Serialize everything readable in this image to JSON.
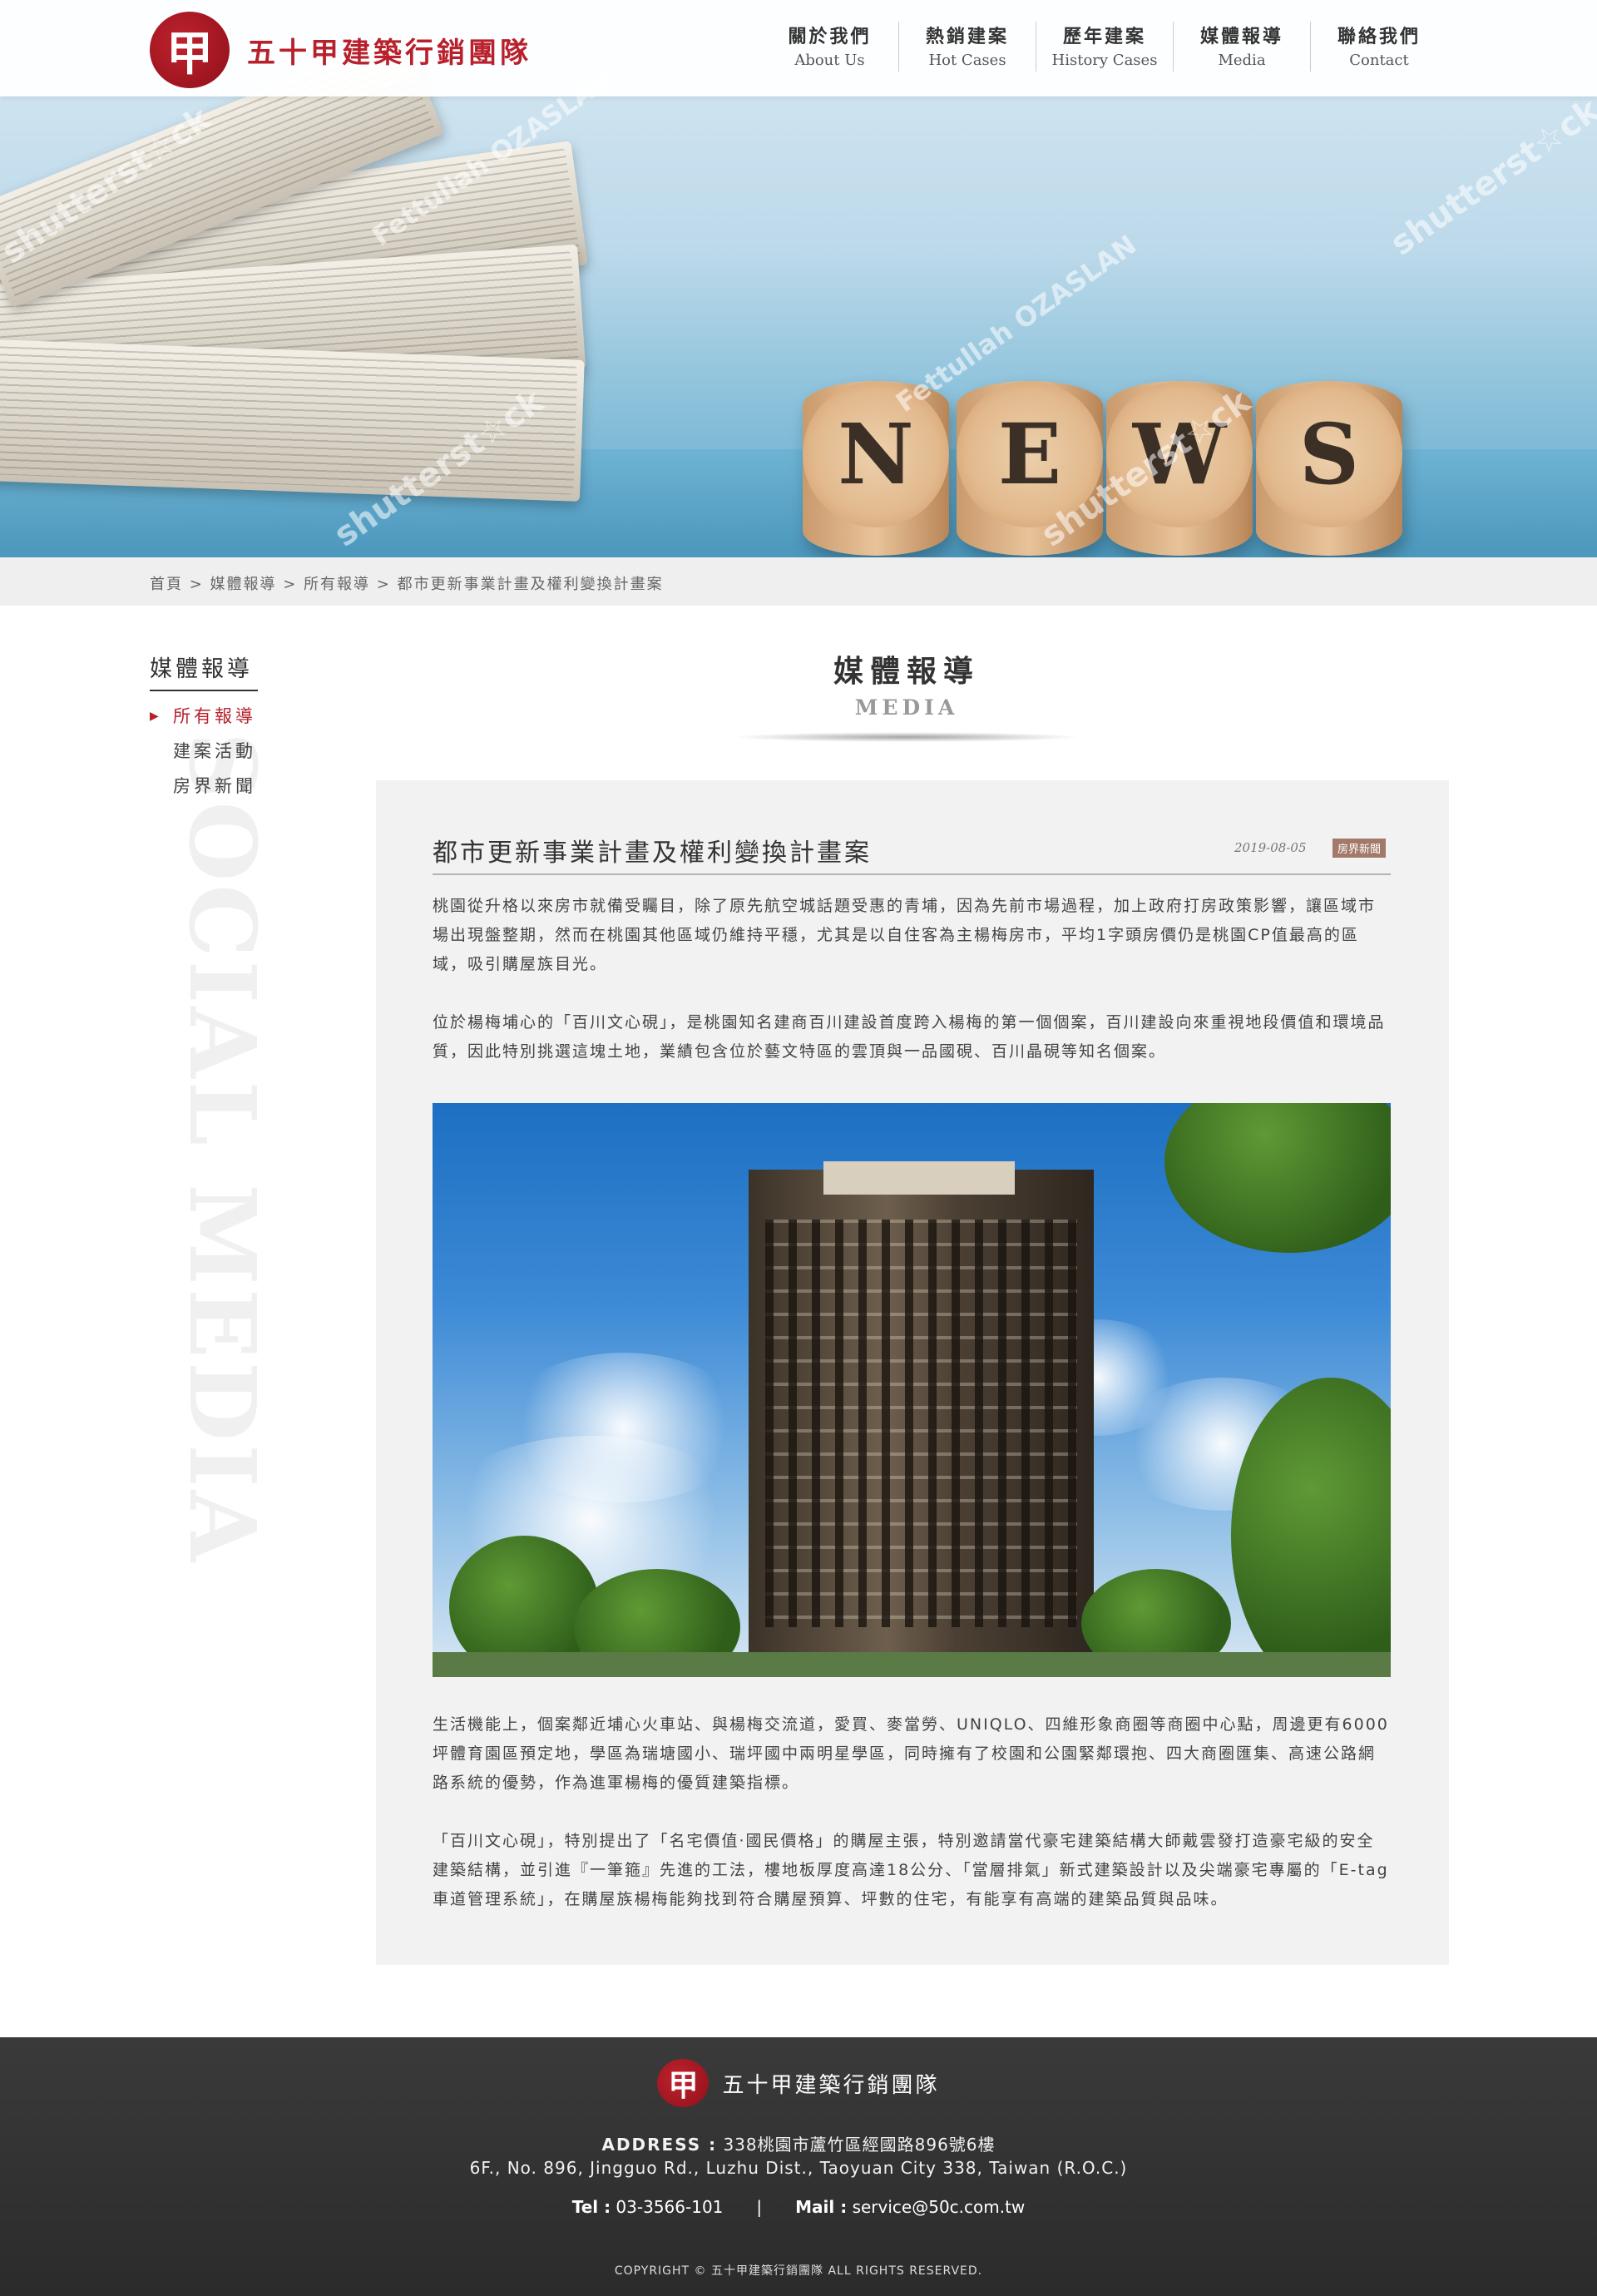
{
  "header": {
    "seal_char": "甲",
    "brand_name": "五十甲建築行銷團隊",
    "nav": [
      {
        "zh": "關於我們",
        "en": "About Us"
      },
      {
        "zh": "熱銷建案",
        "en": "Hot Cases"
      },
      {
        "zh": "歷年建案",
        "en": "History Cases"
      },
      {
        "zh": "媒體報導",
        "en": "Media"
      },
      {
        "zh": "聯絡我們",
        "en": "Contact"
      }
    ]
  },
  "banner": {
    "cork_letters": [
      "N",
      "E",
      "W",
      "S"
    ],
    "watermarks": [
      "shutterst☆ck",
      "Fettullah OZASLAN",
      "shutterst☆ck",
      "Fettullah OZASLAN",
      "shutterst☆ck",
      "shutterst☆ck"
    ]
  },
  "breadcrumb": {
    "items": [
      "首頁",
      "媒體報導",
      "所有報導",
      "都市更新事業計畫及權利變換計畫案"
    ],
    "separator": " > "
  },
  "sidebar": {
    "title": "媒體報導",
    "items": [
      {
        "label": "所有報導",
        "active": true
      },
      {
        "label": "建案活動",
        "active": false
      },
      {
        "label": "房界新聞",
        "active": false
      }
    ],
    "decor_text": "SOCIAL MEDIA"
  },
  "section": {
    "title": "媒體報導",
    "subtitle": "MEDIA"
  },
  "article": {
    "title": "都市更新事業計畫及權利變換計畫案",
    "date": "2019-08-05",
    "tag": "房界新聞",
    "paragraphs": [
      "桃園從升格以來房市就備受矚目，除了原先航空城話題受惠的青埔，因為先前市場過程，加上政府打房政策影響，讓區域市場出現盤整期，然而在桃園其他區域仍維持平穩，尤其是以自住客為主楊梅房市，平均1字頭房價仍是桃園CP值最高的區域，吸引購屋族目光。",
      "位於楊梅埔心的「百川文心硯」，是桃園知名建商百川建設首度跨入楊梅的第一個個案，百川建設向來重視地段價值和環境品質，因此特別挑選這塊土地，業績包含位於藝文特區的雲頂與一品國硯、百川晶硯等知名個案。",
      "生活機能上，個案鄰近埔心火車站、與楊梅交流道，愛買、麥當勞、UNIQLO、四維形象商圈等商圈中心點，周邊更有6000坪體育園區預定地，學區為瑞塘國小、瑞坪國中兩明星學區，同時擁有了校園和公園緊鄰環抱、四大商圈匯集、高速公路網路系統的優勢，作為進軍楊梅的優質建築指標。",
      "「百川文心硯」，特別提出了「名宅價值·國民價格」的購屋主張，特別邀請當代豪宅建築結構大師戴雲發打造豪宅級的安全建築結構，並引進『一筆箍』先進的工法，樓地板厚度高達18公分、「當層排氣」新式建築設計以及尖端豪宅專屬的「E-tag車道管理系統」，在購屋族楊梅能夠找到符合購屋預算、坪數的住宅，有能享有高端的建築品質與品味。"
    ]
  },
  "footer": {
    "seal_char": "甲",
    "brand_name": "五十甲建築行銷團隊",
    "address_label": "ADDRESS :",
    "address_zh": " 338桃園市蘆竹區經國路896號6樓",
    "address_en": "6F., No. 896, Jingguo Rd., Luzhu Dist., Taoyuan City 338, Taiwan (R.O.C.)",
    "tel_label": "Tel :",
    "tel": " 03-3566-101",
    "separator": "|",
    "mail_label": "Mail :",
    "mail": " service@50c.com.tw",
    "copyright": "COPYRIGHT © 五十甲建築行銷團隊 ALL RIGHTS RESERVED."
  },
  "colors": {
    "brand_red": "#b8212c",
    "tag_bg": "#a37a6a",
    "footer_bg": "#333233",
    "card_bg": "#f2f2f2"
  }
}
